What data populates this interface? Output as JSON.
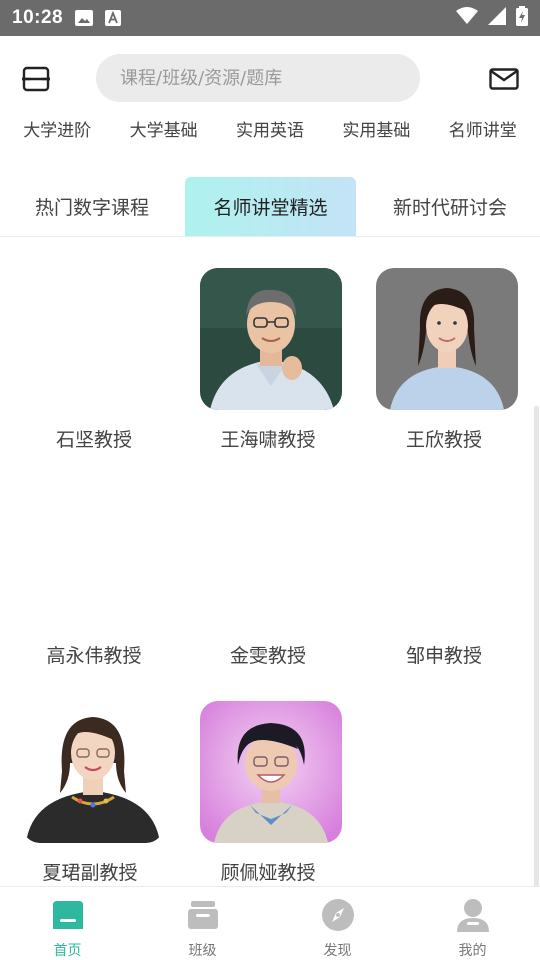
{
  "status_bar": {
    "time": "10:28"
  },
  "search": {
    "placeholder": "课程/班级/资源/题库"
  },
  "categories": [
    "大学进阶",
    "大学基础",
    "实用英语",
    "实用基础",
    "名师讲堂"
  ],
  "tabs": [
    {
      "label": "热门数字课程",
      "active": false
    },
    {
      "label": "名师讲堂精选",
      "active": true
    },
    {
      "label": "新时代研讨会",
      "active": false
    }
  ],
  "teachers": [
    {
      "name": "石坚教授",
      "has_photo": false
    },
    {
      "name": "王海啸教授",
      "has_photo": true
    },
    {
      "name": "王欣教授",
      "has_photo": true
    },
    {
      "name": "高永伟教授",
      "has_photo": false
    },
    {
      "name": "金雯教授",
      "has_photo": false
    },
    {
      "name": "邹申教授",
      "has_photo": false
    },
    {
      "name": "夏珺副教授",
      "has_photo": true
    },
    {
      "name": "顾佩娅教授",
      "has_photo": true
    }
  ],
  "bottom_nav": [
    {
      "label": "首页",
      "icon": "home-icon",
      "active": true
    },
    {
      "label": "班级",
      "icon": "class-icon",
      "active": false
    },
    {
      "label": "发现",
      "icon": "compass-icon",
      "active": false
    },
    {
      "label": "我的",
      "icon": "profile-icon",
      "active": false
    }
  ],
  "colors": {
    "accent": "#2db89f",
    "tab_active_start": "#aef2ee",
    "tab_active_end": "#c4e3f6",
    "status_bar": "#6b6b6b"
  }
}
